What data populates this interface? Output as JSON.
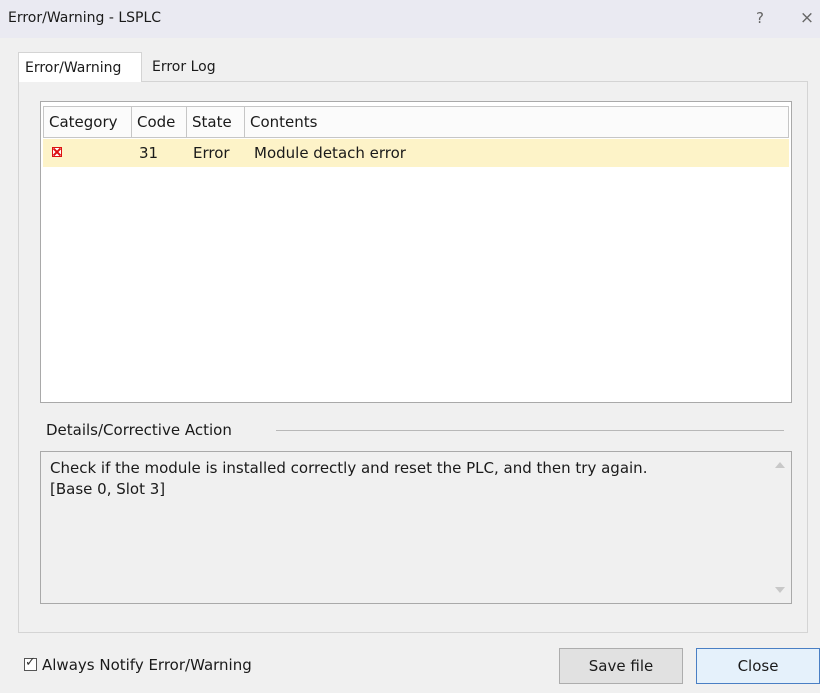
{
  "window": {
    "title": "Error/Warning - LSPLC",
    "help_label": "?",
    "close_label": "×"
  },
  "tabs": [
    {
      "label": "Error/Warning",
      "active": true
    },
    {
      "label": "Error Log",
      "active": false
    }
  ],
  "grid": {
    "columns": [
      "Category",
      "Code",
      "State",
      "Contents"
    ],
    "rows": [
      {
        "category_icon": "error-icon",
        "code": "31",
        "state": "Error",
        "contents": "Module detach error"
      }
    ]
  },
  "details": {
    "label": "Details/Corrective Action",
    "text": "Check if the module is installed correctly and reset the PLC, and then try again.\n[Base 0, Slot 3]"
  },
  "footer": {
    "notify_label": "Always Notify Error/Warning",
    "notify_checked": true,
    "save_label": "Save file",
    "close_label": "Close"
  },
  "colors": {
    "selected_row": "#fdf3c8",
    "error_icon": "#dd1111",
    "default_button_border": "#4a7fc4"
  }
}
